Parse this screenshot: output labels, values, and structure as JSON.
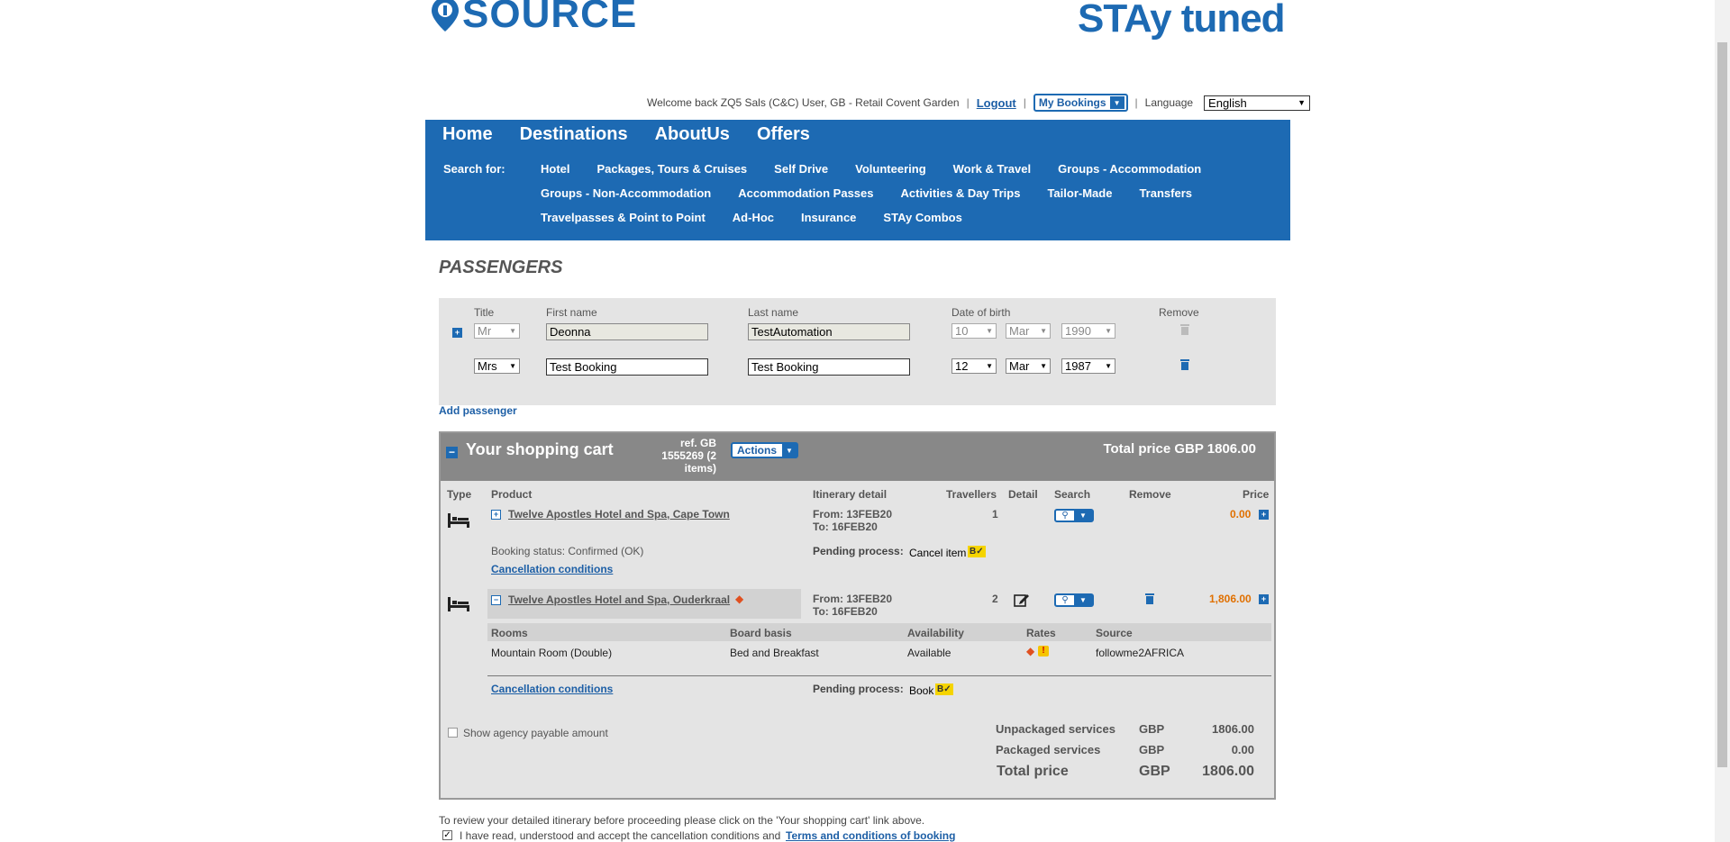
{
  "header": {
    "logo_left": "SOURCE",
    "logo_right": "STAy tuned"
  },
  "userbar": {
    "welcome": "Welcome back ZQ5 Sals (C&C) User, GB - Retail Covent Garden",
    "logout": "Logout",
    "my_bookings": "My Bookings",
    "language_label": "Language",
    "language_value": "English"
  },
  "nav": {
    "main": [
      "Home",
      "Destinations",
      "AboutUs",
      "Offers"
    ],
    "search_for_label": "Search for:",
    "rows": [
      [
        "Hotel",
        "Packages, Tours & Cruises",
        "Self Drive",
        "Volunteering",
        "Work & Travel",
        "Groups - Accommodation"
      ],
      [
        "Groups - Non-Accommodation",
        "Accommodation Passes",
        "Activities & Day Trips",
        "Tailor-Made",
        "Transfers"
      ],
      [
        "Travelpasses & Point to Point",
        "Ad-Hoc",
        "Insurance",
        "STAy Combos"
      ]
    ]
  },
  "passengers": {
    "title": "PASSENGERS",
    "headers": {
      "title": "Title",
      "first": "First name",
      "last": "Last name",
      "dob": "Date of birth",
      "remove": "Remove"
    },
    "rows": [
      {
        "title": "Mr",
        "first": "Deonna",
        "last": "TestAutomation",
        "day": "10",
        "month": "Mar",
        "year": "1990"
      },
      {
        "title": "Mrs",
        "first": "Test Booking",
        "last": "Test Booking",
        "day": "12",
        "month": "Mar",
        "year": "1987"
      }
    ],
    "add_passenger": "Add passenger"
  },
  "cart": {
    "title": "Your shopping cart",
    "ref_line1": "ref. GB",
    "ref_line2": "1555269 (2",
    "ref_line3": "items)",
    "actions": "Actions",
    "total_label": "Total price GBP 1806.00",
    "columns": {
      "type": "Type",
      "product": "Product",
      "itinerary": "Itinerary detail",
      "travellers": "Travellers",
      "detail": "Detail",
      "search": "Search",
      "remove": "Remove",
      "price": "Price"
    },
    "items": [
      {
        "product": "Twelve Apostles Hotel and Spa, Cape Town",
        "from": "From: 13FEB20",
        "to": "To: 16FEB20",
        "travellers": "1",
        "price": "0.00",
        "status": "Booking status: Confirmed (OK)",
        "cancellation": "Cancellation conditions",
        "pending_label": "Pending process:",
        "pending_value": "Cancel item"
      },
      {
        "product": "Twelve Apostles Hotel and Spa, Ouderkraal",
        "from": "From: 13FEB20",
        "to": "To: 16FEB20",
        "travellers": "2",
        "price": "1,806.00",
        "cancellation": "Cancellation conditions",
        "pending_label": "Pending process:",
        "pending_value": "Book"
      }
    ],
    "rooms": {
      "headers": {
        "rooms": "Rooms",
        "board": "Board basis",
        "availability": "Availability",
        "rates": "Rates",
        "source": "Source"
      },
      "row": {
        "room": "Mountain Room (Double)",
        "board": "Bed and Breakfast",
        "availability": "Available",
        "source": "followme2AFRICA"
      }
    },
    "show_agency": "Show agency payable amount",
    "totals": {
      "unpackaged_label": "Unpackaged services",
      "unpackaged_cur": "GBP",
      "unpackaged_val": "1806.00",
      "packaged_label": "Packaged services",
      "packaged_cur": "GBP",
      "packaged_val": "0.00",
      "total_label": "Total price",
      "total_cur": "GBP",
      "total_val": "1806.00"
    }
  },
  "footer": {
    "review_text": "To review your detailed itinerary before proceeding please click on the 'Your shopping cart' link above.",
    "accept_text": "I have read, understood and accept the cancellation conditions and",
    "terms_link": "Terms and conditions of booking"
  },
  "colors": {
    "brand_blue": "#1d6ab3",
    "cart_header": "#888888",
    "price_orange": "#e07000"
  }
}
